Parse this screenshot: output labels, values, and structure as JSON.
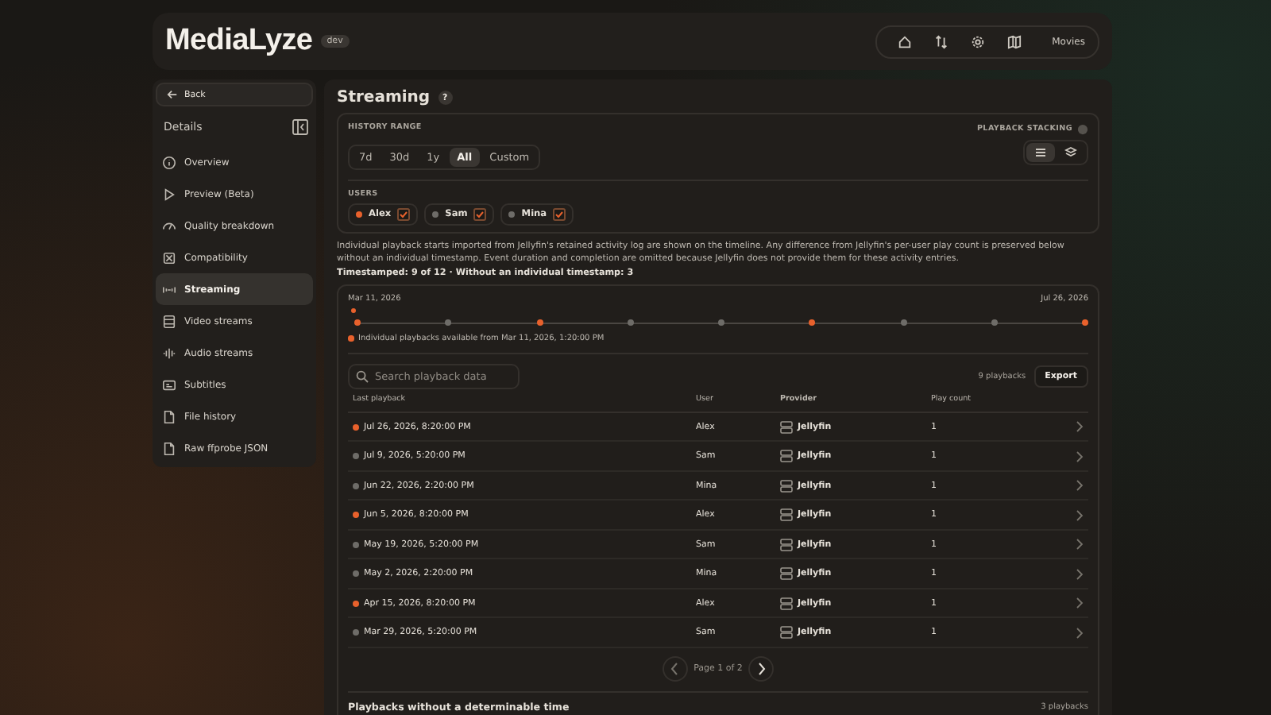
{
  "header": {
    "logo": "MediaLyze",
    "badge": "dev",
    "nav_label": "Movies"
  },
  "sidebar": {
    "back": "Back",
    "title": "Details",
    "items": [
      {
        "label": "Overview",
        "selected": false
      },
      {
        "label": "Preview (Beta)",
        "selected": false
      },
      {
        "label": "Quality breakdown",
        "selected": false
      },
      {
        "label": "Compatibility",
        "selected": false
      },
      {
        "label": "Streaming",
        "selected": true
      },
      {
        "label": "Video streams",
        "selected": false
      },
      {
        "label": "Audio streams",
        "selected": false
      },
      {
        "label": "Subtitles",
        "selected": false
      },
      {
        "label": "File history",
        "selected": false
      },
      {
        "label": "Raw ffprobe JSON",
        "selected": false
      }
    ]
  },
  "page": {
    "title": "Streaming",
    "help": "?"
  },
  "filters": {
    "range_label": "HISTORY RANGE",
    "ranges": [
      {
        "label": "7d",
        "selected": false
      },
      {
        "label": "30d",
        "selected": false
      },
      {
        "label": "1y",
        "selected": false
      },
      {
        "label": "All",
        "selected": true
      },
      {
        "label": "Custom",
        "selected": false
      }
    ],
    "stacking_label": "PLAYBACK STACKING",
    "stacking": [
      {
        "selected": true
      },
      {
        "selected": false
      }
    ],
    "users_label": "USERS",
    "users": [
      {
        "name": "Alex",
        "color": "#e8612c",
        "checked": true
      },
      {
        "name": "Sam",
        "color": "#6e6c68",
        "checked": true
      },
      {
        "name": "Mina",
        "color": "#6e6c68",
        "checked": true
      }
    ]
  },
  "note": "Individual playback starts imported from Jellyfin's retained activity log are shown on the timeline. Any difference from Jellyfin's per-user play count is preserved below without an individual timestamp. Event duration and completion are omitted because Jellyfin does not provide them for these activity entries.",
  "summary": "Timestamped: 9 of 12 · Without an individual timestamp: 3",
  "timeline": {
    "start": "Mar 11, 2026",
    "end": "Jul 26, 2026",
    "points": [
      {
        "color": "#e8612c"
      },
      {
        "color": "#6e6c68"
      },
      {
        "color": "#e8612c"
      },
      {
        "color": "#6e6c68"
      },
      {
        "color": "#6e6c68"
      },
      {
        "color": "#e8612c"
      },
      {
        "color": "#6e6c68"
      },
      {
        "color": "#6e6c68"
      },
      {
        "color": "#e8612c"
      }
    ],
    "legend": "Individual playbacks available from Mar 11, 2026, 1:20:00 PM"
  },
  "table": {
    "search_placeholder": "Search playback data",
    "count": "9 playbacks",
    "export": "Export",
    "columns": [
      "Last playback",
      "User",
      "Provider",
      "Play count"
    ],
    "rows": [
      {
        "date": "Jul 26, 2026, 8:20:00 PM",
        "color": "#e8612c",
        "user": "Alex",
        "provider": "Jellyfin",
        "count": "1"
      },
      {
        "date": "Jul 9, 2026, 5:20:00 PM",
        "color": "#6e6c68",
        "user": "Sam",
        "provider": "Jellyfin",
        "count": "1"
      },
      {
        "date": "Jun 22, 2026, 2:20:00 PM",
        "color": "#6e6c68",
        "user": "Mina",
        "provider": "Jellyfin",
        "count": "1"
      },
      {
        "date": "Jun 5, 2026, 8:20:00 PM",
        "color": "#e8612c",
        "user": "Alex",
        "provider": "Jellyfin",
        "count": "1"
      },
      {
        "date": "May 19, 2026, 5:20:00 PM",
        "color": "#6e6c68",
        "user": "Sam",
        "provider": "Jellyfin",
        "count": "1"
      },
      {
        "date": "May 2, 2026, 2:20:00 PM",
        "color": "#6e6c68",
        "user": "Mina",
        "provider": "Jellyfin",
        "count": "1"
      },
      {
        "date": "Apr 15, 2026, 8:20:00 PM",
        "color": "#e8612c",
        "user": "Alex",
        "provider": "Jellyfin",
        "count": "1"
      },
      {
        "date": "Mar 29, 2026, 5:20:00 PM",
        "color": "#6e6c68",
        "user": "Sam",
        "provider": "Jellyfin",
        "count": "1"
      }
    ],
    "pagination": "Page 1 of 2"
  },
  "untimed": {
    "title": "Playbacks without a determinable time",
    "count": "3 playbacks"
  }
}
